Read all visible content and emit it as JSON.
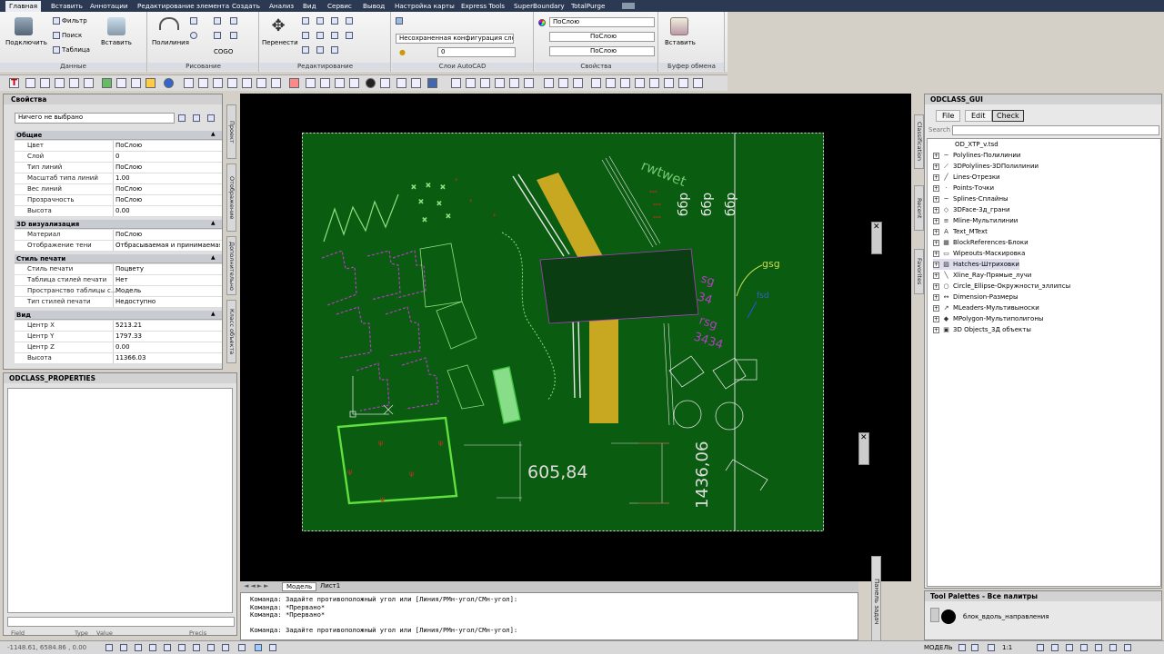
{
  "ribbon_tabs": [
    "Главная",
    "Вставить",
    "Аннотации",
    "Редактирование элемента",
    "Создать",
    "Анализ",
    "Вид",
    "Сервис",
    "Вывод",
    "Настройка карты",
    "Express Tools",
    "SuperBoundary",
    "TotalPurge"
  ],
  "ribbon": {
    "connect": "Подключить",
    "filter": "Фильтр",
    "search": "Поиск",
    "table": "Таблица",
    "insert": "Вставить",
    "group_data": "Данные",
    "polyline": "Полилиния",
    "cogo": "COGO",
    "group_draw": "Рисование",
    "move": "Перенести",
    "group_edit": "Редактирование",
    "layer_combo": "Несохраненная конфигурация слоев",
    "layer_current": "0",
    "group_layers": "Слои AutoCAD",
    "color_combo": "ПоСлою",
    "linetype_combo": "ПоСлою",
    "lineweight_combo": "ПоСлою",
    "group_props": "Свойства",
    "paste": "Вставить",
    "group_clipboard": "Буфер обмена"
  },
  "properties": {
    "title": "Свойства",
    "selection": "Ничего не выбрано",
    "sections": [
      {
        "name": "Общие",
        "rows": [
          [
            "Цвет",
            "ПоСлою"
          ],
          [
            "Слой",
            "0"
          ],
          [
            "Тип линий",
            "ПоСлою"
          ],
          [
            "Масштаб типа линий",
            "1.00"
          ],
          [
            "Вес линий",
            "ПоСлою"
          ],
          [
            "Прозрачность",
            "ПоСлою"
          ],
          [
            "Высота",
            "0.00"
          ]
        ]
      },
      {
        "name": "3D визуализация",
        "rows": [
          [
            "Материал",
            "ПоСлою"
          ],
          [
            "Отображение тени",
            "Отбрасываемая и принимаемая ..."
          ]
        ]
      },
      {
        "name": "Стиль печати",
        "rows": [
          [
            "Стиль печати",
            "Поцвету"
          ],
          [
            "Таблица стилей печати",
            "Нет"
          ],
          [
            "Пространство таблицы с...",
            "Модель"
          ],
          [
            "Тип стилей печати",
            "Недоступно"
          ]
        ]
      },
      {
        "name": "Вид",
        "rows": [
          [
            "Центр X",
            "5213.21"
          ],
          [
            "Центр Y",
            "1797.33"
          ],
          [
            "Центр Z",
            "0.00"
          ],
          [
            "Высота",
            "11366.03"
          ]
        ]
      }
    ],
    "side_tabs": [
      "Проект",
      "Отображение",
      "Дополнительно",
      "Класс объекта"
    ]
  },
  "odclass_properties": {
    "title": "ODCLASS_PROPERTIES",
    "columns": [
      "Field",
      "Type",
      "Value",
      "Precis"
    ]
  },
  "drawing": {
    "texts": {
      "rwtwet": "rwtwet",
      "gsg": "gsg",
      "sg": "sg",
      "n34": "34",
      "rsg": "rsg",
      "n3434": "3434",
      "bbp1": "ббр",
      "bbp2": "ббр",
      "dim1": "605,84",
      "dim2": "1436,06",
      "blue": "fsd"
    },
    "colors": {
      "bg": "#0a5c10",
      "magenta": "#b040c0",
      "yellow": "#c8a820",
      "green": "#60e040",
      "lightgreen": "#8fe080",
      "white": "#e8e8e8",
      "red": "#c83020",
      "text_green": "#70c870"
    }
  },
  "layout_tabs": [
    "Модель",
    "Лист1"
  ],
  "command_lines": [
    "Команда: Задайте противоположный угол или [Линия/РМн-угол/СМн-угол]:",
    "Команда: *Прервано*",
    "Команда: *Прервано*",
    "",
    "Команда: Задайте противоположный угол или [Линия/РМн-угол/СМн-угол]:"
  ],
  "statusbar": {
    "coords": "-1148.61, 6584.86 , 0.00",
    "model": "МОДЕЛЬ",
    "scale": "1:1"
  },
  "odclass_gui": {
    "title": "ODCLASS_GUI",
    "menu": [
      "File",
      "Edit",
      "Check"
    ],
    "search_label": "Search",
    "side_tabs": [
      "Classification",
      "Recent",
      "Favorites"
    ],
    "root": "OD_XTP_v.tsd",
    "items": [
      "Polylines-Полилинии",
      "3DPolylines-3DПолилинии",
      "Lines-Отрезки",
      "Points-Точки",
      "Splines-Сплайны",
      "3DFace-3д_грани",
      "Mline-Мультилинии",
      "Text_MText",
      "BlockReferences-Блоки",
      "Wipeouts-Маскировка",
      "Hatches-Штриховки",
      "Xline_Ray-Прямые_лучи",
      "Circle_Ellipse-Окружности_эллипсы",
      "Dimension-Размеры",
      "MLeaders-Мультивыноски",
      "MPolygon-Мультиполигоны",
      "3D Objects_3Д объекты"
    ],
    "icons": [
      "spline-icon",
      "polyline3d-icon",
      "line-icon",
      "point-icon",
      "spline-icon",
      "face-icon",
      "mline-icon",
      "text-icon",
      "block-icon",
      "wipeout-icon",
      "hatch-icon",
      "xline-icon",
      "circle-icon",
      "dimension-icon",
      "mleader-icon",
      "mpolygon-icon",
      "solid-icon"
    ]
  },
  "tool_palettes": {
    "title": "Tool Palettes - Все палитры",
    "item": "блок_вдоль_направления"
  },
  "task_panel_label": "Панель задач"
}
